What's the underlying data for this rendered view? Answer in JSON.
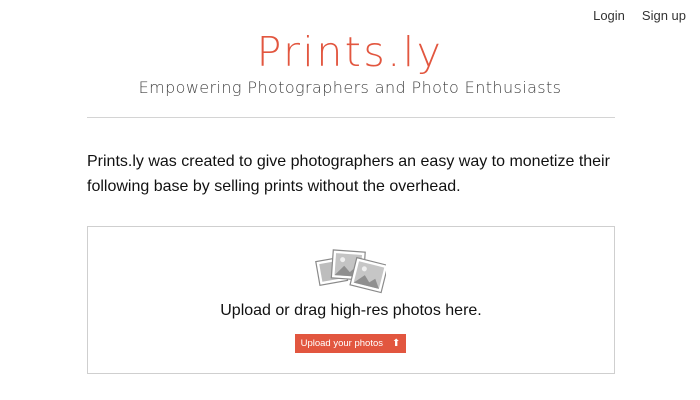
{
  "nav": {
    "login_label": "Login",
    "signup_label": "Sign up"
  },
  "brand": {
    "name": "Prints.ly",
    "tagline": "Empowering Photographers and Photo Enthusiasts"
  },
  "intro": {
    "text": "Prints.ly was created to give photographers an easy way to monetize their following base by selling prints without the overhead."
  },
  "upload": {
    "icon": "photos-icon",
    "prompt": "Upload or drag high-res photos here.",
    "button_label": "Upload your photos",
    "button_icon": "arrow-up-icon"
  },
  "colors": {
    "accent": "#e2563f",
    "divider": "#d4d4d4",
    "border": "#cfcfcf"
  }
}
